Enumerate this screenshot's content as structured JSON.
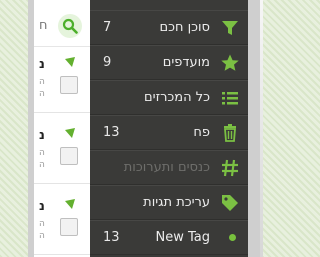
{
  "search": {
    "fragment": "ח"
  },
  "task_rows": [
    {
      "label_fragment": "נ",
      "sub_lines": [
        "ה",
        "ה"
      ]
    },
    {
      "label_fragment": "נ",
      "sub_lines": [
        "ה",
        "ה"
      ]
    },
    {
      "label_fragment": "נ",
      "sub_lines": [
        "ה",
        "ה"
      ]
    }
  ],
  "sidebar": {
    "items": [
      {
        "label": "סוכן חכם",
        "count": "7",
        "icon": "funnel-icon"
      },
      {
        "label": "מועדפים",
        "count": "9",
        "icon": "star-icon"
      },
      {
        "label": "כל המכרזים",
        "count": "",
        "icon": "list-icon"
      },
      {
        "label": "פח",
        "count": "13",
        "icon": "trash-icon"
      },
      {
        "label": "כנסים ותערוכות",
        "count": "",
        "icon": "hashtag-icon",
        "disabled": true
      },
      {
        "label": "עריכת תגיות",
        "count": "",
        "icon": "tag-icon"
      },
      {
        "label": "New Tag",
        "count": "13",
        "icon": "dot-icon"
      }
    ]
  },
  "colors": {
    "accent": "#78c13d",
    "sidebar_bg": "#3a3a38"
  }
}
